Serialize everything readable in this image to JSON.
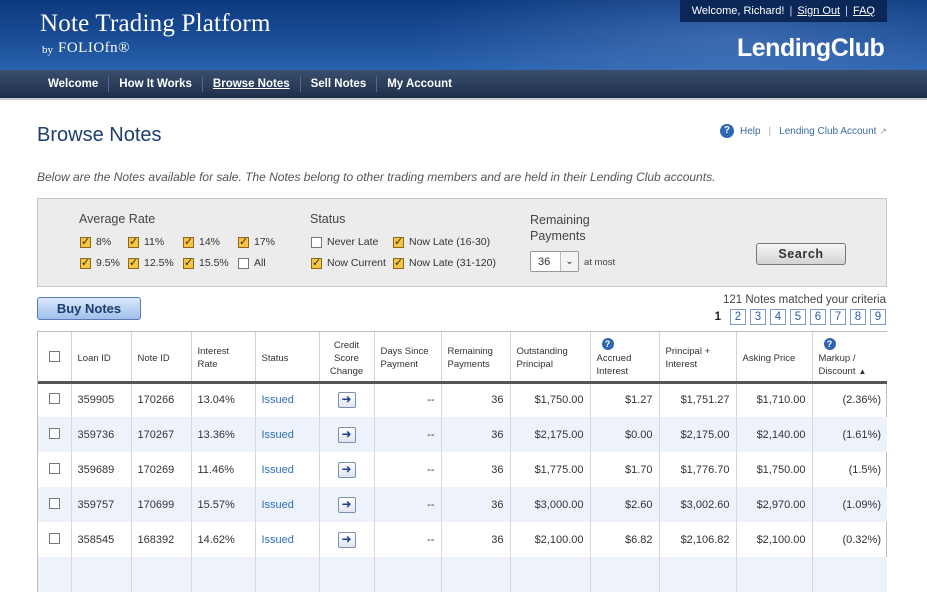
{
  "header": {
    "title": "Note Trading Platform",
    "by": "by",
    "folio": "FOLIOfn®",
    "welcome": "Welcome, Richard!",
    "sign_out": "Sign Out",
    "faq": "FAQ",
    "logo": "LendingClub"
  },
  "nav": [
    "Welcome",
    "How It Works",
    "Browse Notes",
    "Sell Notes",
    "My Account"
  ],
  "page": {
    "title": "Browse Notes",
    "help": "Help",
    "lc_account": "Lending Club Account",
    "intro": "Below are the Notes available for sale. The Notes belong to other trading members and are held in their Lending Club accounts."
  },
  "filters": {
    "avg_rate_title": "Average Rate",
    "rates": [
      {
        "label": "8%",
        "checked": true
      },
      {
        "label": "11%",
        "checked": true
      },
      {
        "label": "14%",
        "checked": true
      },
      {
        "label": "17%",
        "checked": true
      },
      {
        "label": "9.5%",
        "checked": true
      },
      {
        "label": "12.5%",
        "checked": true
      },
      {
        "label": "15.5%",
        "checked": true
      },
      {
        "label": "All",
        "checked": false
      }
    ],
    "status_title": "Status",
    "statuses": [
      {
        "label": "Never Late",
        "checked": false
      },
      {
        "label": "Now Late (16-30)",
        "checked": true
      },
      {
        "label": "Now Current",
        "checked": true
      },
      {
        "label": "Now Late (31-120)",
        "checked": true
      }
    ],
    "remaining_title_1": "Remaining",
    "remaining_title_2": "Payments",
    "remaining_value": "36",
    "at_most": "at most",
    "search": "Search"
  },
  "actions": {
    "buy": "Buy Notes",
    "matched": "121 Notes matched your criteria",
    "current_page": "1",
    "pages": [
      "2",
      "3",
      "4",
      "5",
      "6",
      "7",
      "8",
      "9"
    ]
  },
  "table": {
    "headers": {
      "loan_id": "Loan ID",
      "note_id": "Note ID",
      "rate": "Interest Rate",
      "status": "Status",
      "credit": "Credit Score Change",
      "days": "Days Since Payment",
      "remaining": "Remaining Payments",
      "outstanding": "Outstanding Principal",
      "accrued": "Accrued Interest",
      "pi": "Principal + Interest",
      "asking": "Asking Price",
      "markup": "Markup / Discount"
    },
    "rows": [
      {
        "loan_id": "359905",
        "note_id": "170266",
        "rate": "13.04%",
        "status": "Issued",
        "days": "--",
        "remaining": "36",
        "outstanding": "$1,750.00",
        "accrued": "$1.27",
        "pi": "$1,751.27",
        "asking": "$1,710.00",
        "markup": "(2.36%)"
      },
      {
        "loan_id": "359736",
        "note_id": "170267",
        "rate": "13.36%",
        "status": "Issued",
        "days": "--",
        "remaining": "36",
        "outstanding": "$2,175.00",
        "accrued": "$0.00",
        "pi": "$2,175.00",
        "asking": "$2,140.00",
        "markup": "(1.61%)"
      },
      {
        "loan_id": "359689",
        "note_id": "170269",
        "rate": "11.46%",
        "status": "Issued",
        "days": "--",
        "remaining": "36",
        "outstanding": "$1,775.00",
        "accrued": "$1.70",
        "pi": "$1,776.70",
        "asking": "$1,750.00",
        "markup": "(1.5%)"
      },
      {
        "loan_id": "359757",
        "note_id": "170699",
        "rate": "15.57%",
        "status": "Issued",
        "days": "--",
        "remaining": "36",
        "outstanding": "$3,000.00",
        "accrued": "$2.60",
        "pi": "$3,002.60",
        "asking": "$2,970.00",
        "markup": "(1.09%)"
      },
      {
        "loan_id": "358545",
        "note_id": "168392",
        "rate": "14.62%",
        "status": "Issued",
        "days": "--",
        "remaining": "36",
        "outstanding": "$2,100.00",
        "accrued": "$6.82",
        "pi": "$2,106.82",
        "asking": "$2,100.00",
        "markup": "(0.32%)"
      },
      {
        "loan_id": "",
        "note_id": "",
        "rate": "",
        "status": "",
        "days": "",
        "remaining": "",
        "outstanding": "",
        "accrued": "",
        "pi": "",
        "asking": "",
        "markup": ""
      }
    ]
  },
  "colors": {
    "header_blue": "#1a4d96",
    "nav_dark": "#1d2e49",
    "link_blue": "#2f6fb5",
    "checked_gold": "#f6c445",
    "row_alt": "#eef3fb"
  }
}
